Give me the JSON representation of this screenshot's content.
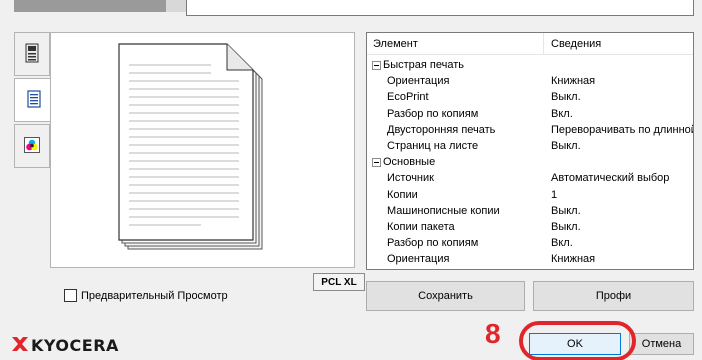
{
  "details": {
    "col_element": "Элемент",
    "col_info": "Сведения",
    "rows": [
      {
        "type": "group",
        "name": "Быстрая печать",
        "value": ""
      },
      {
        "type": "item",
        "name": "Ориентация",
        "value": "Книжная"
      },
      {
        "type": "item",
        "name": "EcoPrint",
        "value": "Выкл."
      },
      {
        "type": "item",
        "name": "Разбор по копиям",
        "value": "Вкл."
      },
      {
        "type": "item",
        "name": "Двусторонняя печать",
        "value": "Переворачивать по длинной с"
      },
      {
        "type": "item",
        "name": "Страниц на листе",
        "value": "Выкл."
      },
      {
        "type": "group",
        "name": "Основные",
        "value": ""
      },
      {
        "type": "item",
        "name": "Источник",
        "value": "Автоматический выбор"
      },
      {
        "type": "item",
        "name": "Копии",
        "value": "1"
      },
      {
        "type": "item",
        "name": "Машинописные копии",
        "value": "Выкл."
      },
      {
        "type": "item",
        "name": "Копии пакета",
        "value": "Выкл."
      },
      {
        "type": "item",
        "name": "Разбор по копиям",
        "value": "Вкл."
      },
      {
        "type": "item",
        "name": "Ориентация",
        "value": "Книжная"
      }
    ]
  },
  "preview": {
    "pcl_badge": "PCL XL"
  },
  "checkbox": {
    "label": "Предварительный Просмотр",
    "checked": false
  },
  "buttons": {
    "save": "Сохранить",
    "profi": "Профи",
    "ok": "OK",
    "cancel": "Отмена"
  },
  "annotation": {
    "step_number": "8",
    "color": "#e0262b"
  },
  "logo": {
    "text": "KYOCERA",
    "brand_color": "#e0262b"
  },
  "side_tabs": [
    {
      "icon": "printer-icon",
      "active": false
    },
    {
      "icon": "document-icon",
      "active": true
    },
    {
      "icon": "color-icon",
      "active": false
    }
  ]
}
